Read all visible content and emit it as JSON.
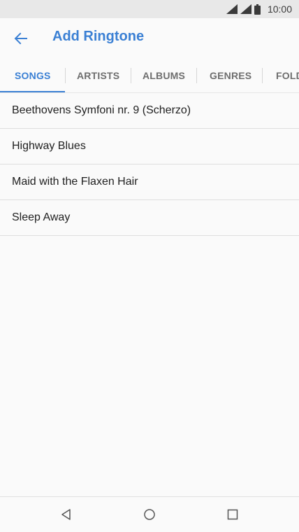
{
  "status_bar": {
    "time": "10:00",
    "icons": [
      "signal-icon",
      "signal-icon",
      "battery-icon"
    ]
  },
  "app_bar": {
    "title": "Add Ringtone",
    "back_icon": "back-arrow-icon"
  },
  "tabs": [
    {
      "label": "SONGS",
      "active": true
    },
    {
      "label": "ARTISTS",
      "active": false
    },
    {
      "label": "ALBUMS",
      "active": false
    },
    {
      "label": "GENRES",
      "active": false
    },
    {
      "label": "FOLD",
      "active": false
    }
  ],
  "songs": [
    {
      "title": "Beethovens Symfoni nr. 9 (Scherzo)"
    },
    {
      "title": "Highway Blues"
    },
    {
      "title": "Maid with the Flaxen Hair"
    },
    {
      "title": "Sleep Away"
    }
  ],
  "nav_bar": {
    "icons": [
      "back-triangle-icon",
      "home-circle-icon",
      "recents-square-icon"
    ]
  },
  "colors": {
    "accent": "#3b80d4",
    "status_bar_bg": "#e8e8e8",
    "background": "#fafafa",
    "text_primary": "#212121",
    "tab_inactive": "#6e6e6e"
  }
}
